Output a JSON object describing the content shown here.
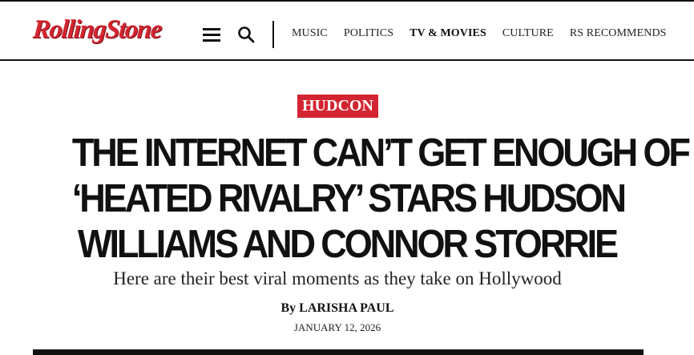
{
  "header": {
    "logo_text": "RollingStone",
    "brand_color": "#d32531",
    "menu_icon": "hamburger-menu-icon",
    "search_icon": "search-icon",
    "nav": [
      {
        "label": "MUSIC",
        "active": false
      },
      {
        "label": "POLITICS",
        "active": false
      },
      {
        "label": "TV & MOVIES",
        "active": true
      },
      {
        "label": "CULTURE",
        "active": false
      },
      {
        "label": "RS RECOMMENDS",
        "active": false
      }
    ]
  },
  "article": {
    "tag": "HUDCON",
    "headline_lines": [
      "THE INTERNET CAN’T GET ENOUGH OF",
      "‘HEATED RIVALRY’ STARS HUDSON",
      "WILLIAMS AND CONNOR STORRIE"
    ],
    "subhead": "Here are their best viral moments as they take on Hollywood",
    "byline_prefix": "By",
    "author": "LARISHA PAUL",
    "date": "JANUARY 12, 2026"
  }
}
